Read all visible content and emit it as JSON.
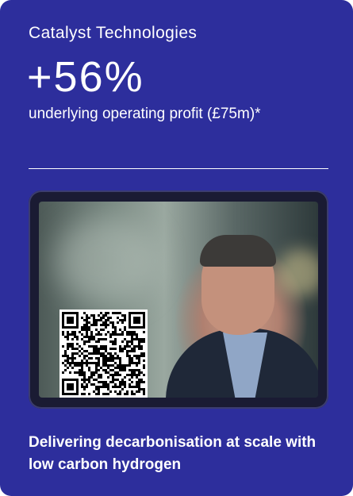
{
  "card": {
    "segment_name": "Catalyst Technologies",
    "metric_value": "+56%",
    "metric_description": "underlying operating profit (£75m)*",
    "tagline": "Delivering decarbonisation at scale with low carbon hydrogen"
  },
  "media": {
    "image_subject": "photo-man-smiling",
    "qr_code": "qr-code-icon"
  },
  "colors": {
    "card_background": "#2d2e9c",
    "text": "#ffffff"
  }
}
